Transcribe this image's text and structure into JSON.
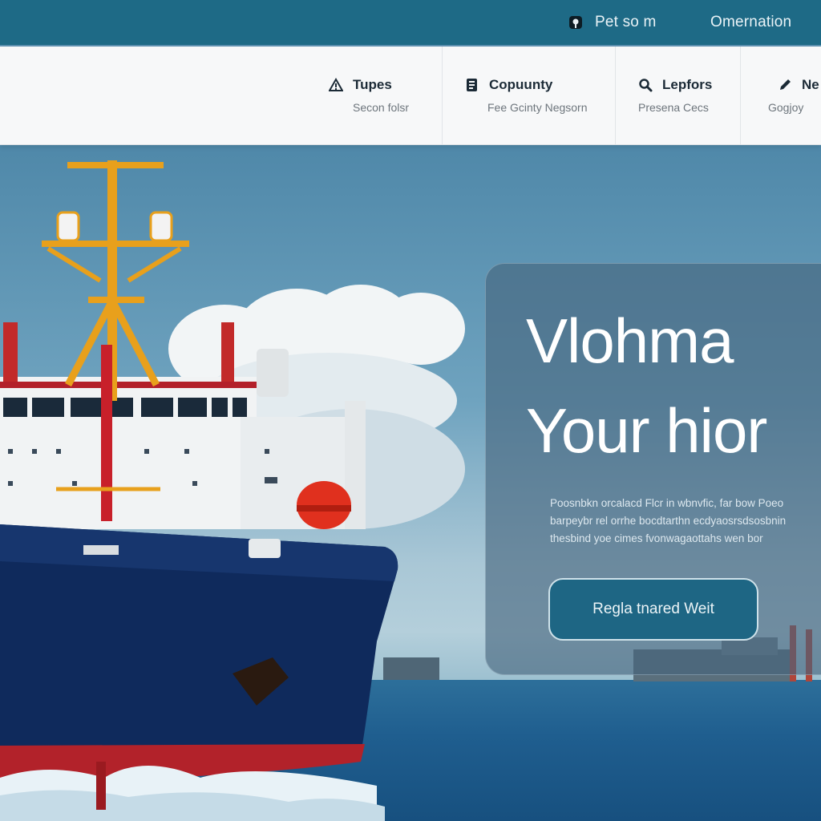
{
  "header": {
    "links": [
      {
        "label": "Pet so m",
        "icon": "login-icon"
      },
      {
        "label": "Omernation"
      }
    ]
  },
  "features": [
    {
      "title": "Tupes",
      "subtitle": "Secon folsr",
      "icon": "warning-icon"
    },
    {
      "title": "Copuunty",
      "subtitle": "Fee Gcinty Negsorn",
      "icon": "document-icon"
    },
    {
      "title": "Lepfors",
      "subtitle": "Presena Cecs",
      "icon": "search-icon"
    },
    {
      "title": "Ne",
      "subtitle": "Gogjoy",
      "icon": "pencil-icon"
    }
  ],
  "hero": {
    "headline_line1": "Vlohma",
    "headline_line2": "Your hior",
    "description_lines": [
      "Poosnbkn orcalacd Flcr in wbnvfic, far bow Poeo",
      "barpeybr rel orrhe bocdtarthn ecdyaosrsdsosbnin",
      "thesbind yoe cimes fvonwagaottahs wen bor"
    ],
    "cta_label": "Regla tnared Weit"
  },
  "colors": {
    "topbar": "#1e6a86",
    "strip": "#f7f8f9",
    "cta": "#1e6684",
    "hull": "#0f2a5c",
    "mast": "#e8a01c"
  }
}
